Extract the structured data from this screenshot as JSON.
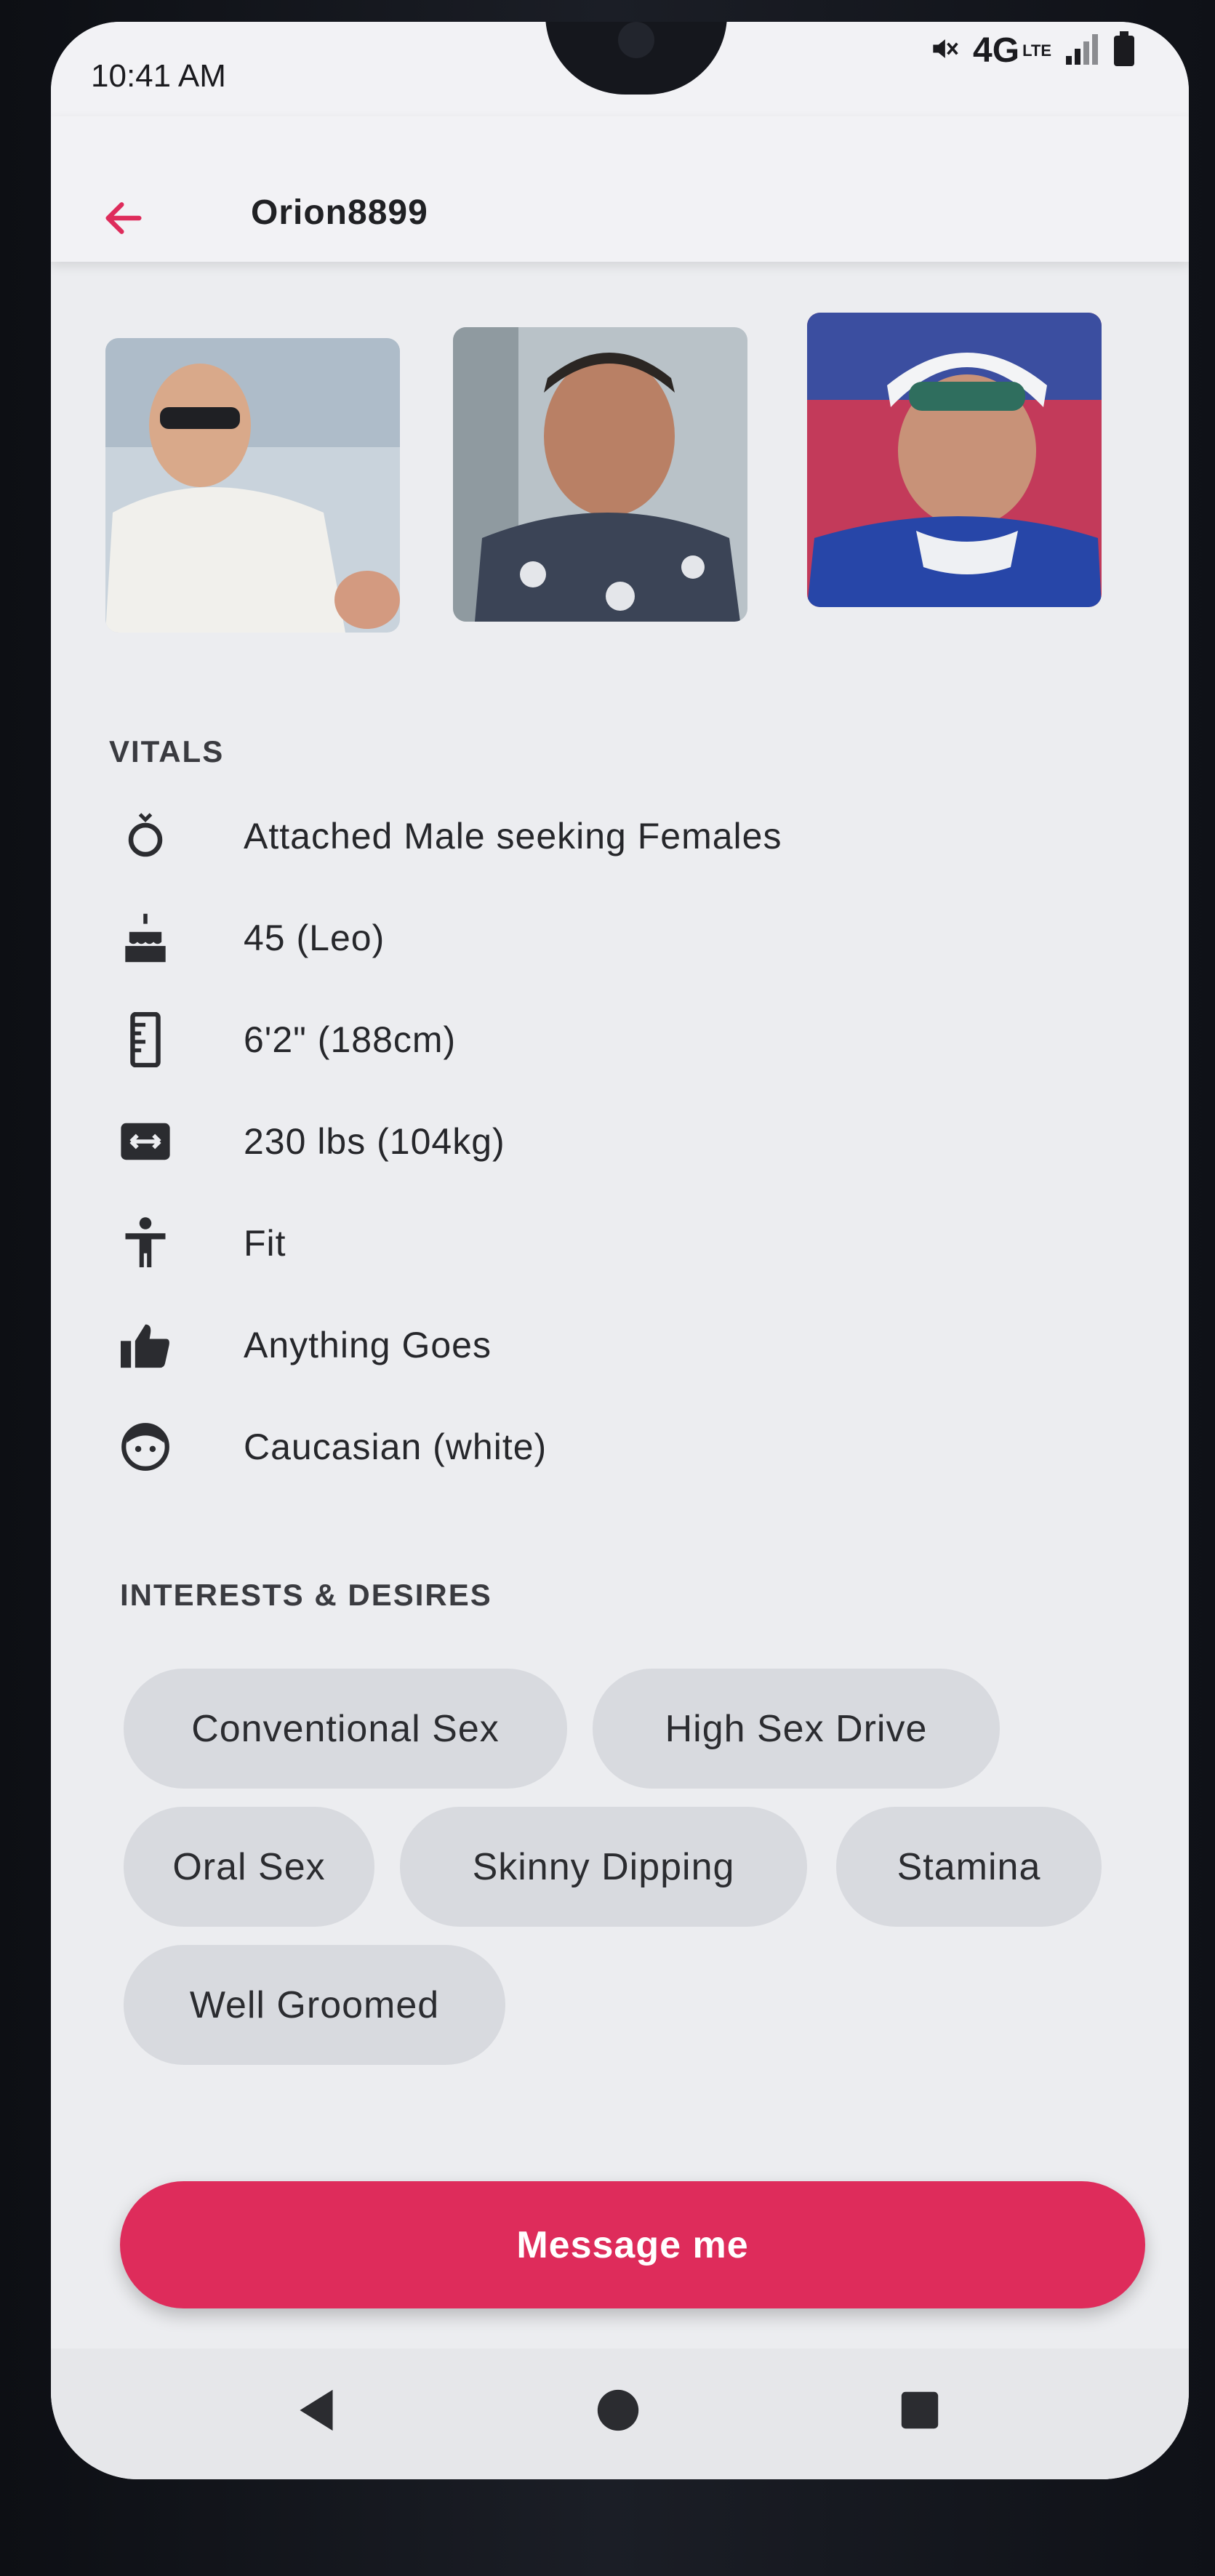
{
  "status_bar": {
    "time": "10:41 AM",
    "network": "4G",
    "network_sub": "LTE"
  },
  "header": {
    "title": "Orion8899"
  },
  "vitals": {
    "heading": "VITALS",
    "items": [
      {
        "icon": "ring-icon",
        "text": "Attached Male seeking Females"
      },
      {
        "icon": "cake-icon",
        "text": "45 (Leo)"
      },
      {
        "icon": "ruler-icon",
        "text": "6'2\" (188cm)"
      },
      {
        "icon": "weight-icon",
        "text": "230 lbs (104kg)"
      },
      {
        "icon": "body-type-icon",
        "text": "Fit"
      },
      {
        "icon": "thumbs-up-icon",
        "text": "Anything Goes"
      },
      {
        "icon": "face-icon",
        "text": "Caucasian (white)"
      }
    ]
  },
  "interests": {
    "heading": "INTERESTS & DESIRES",
    "tags": [
      "Conventional Sex",
      "High Sex Drive",
      "Oral Sex",
      "Skinny Dipping",
      "Stamina",
      "Well Groomed"
    ]
  },
  "cta": {
    "message_label": "Message me"
  },
  "colors": {
    "accent": "#de2c5b",
    "chip_bg": "#d8dadf",
    "screen_bg": "#ecedf0"
  }
}
